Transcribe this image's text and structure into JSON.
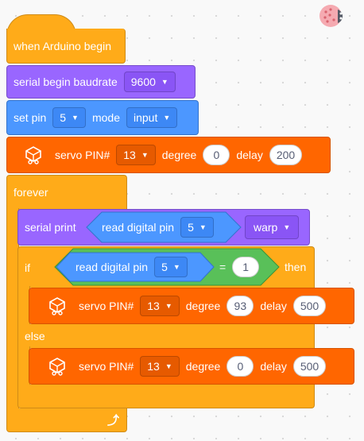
{
  "blocks": {
    "hat": {
      "label": "when Arduino begin"
    },
    "serial_begin": {
      "label": "serial begin baudrate",
      "baud": "9600"
    },
    "set_pin": {
      "label_set": "set pin",
      "pin": "5",
      "label_mode": "mode",
      "mode": "input"
    },
    "servo_top": {
      "label_pin": "servo PIN#",
      "pin": "13",
      "label_degree": "degree",
      "degree": "0",
      "label_delay": "delay",
      "delay": "200"
    },
    "forever": {
      "label": "forever"
    },
    "serial_print": {
      "label": "serial print",
      "reporter": "read digital pin",
      "pin": "5",
      "option": "warp"
    },
    "if_block": {
      "label_if": "if",
      "reporter": "read digital pin",
      "pin": "5",
      "operator": "=",
      "compare_value": "1",
      "label_then": "then",
      "label_else": "else"
    },
    "servo_then": {
      "label_pin": "servo PIN#",
      "pin": "13",
      "label_degree": "degree",
      "degree": "93",
      "label_delay": "delay",
      "delay": "500"
    },
    "servo_else": {
      "label_pin": "servo PIN#",
      "pin": "13",
      "label_degree": "degree",
      "degree": "0",
      "label_delay": "delay",
      "delay": "500"
    }
  },
  "icons": {
    "dropdown": "triangle-down-icon",
    "servo": "servo-motor-icon",
    "loop": "loop-arrow-icon",
    "sprite": "ladybug-sprite-icon"
  },
  "colors": {
    "events": "#ffab19",
    "serial": "#9966ff",
    "pins": "#4c97ff",
    "servo": "#ff6600",
    "operators": "#59c059",
    "control": "#ffab19"
  }
}
